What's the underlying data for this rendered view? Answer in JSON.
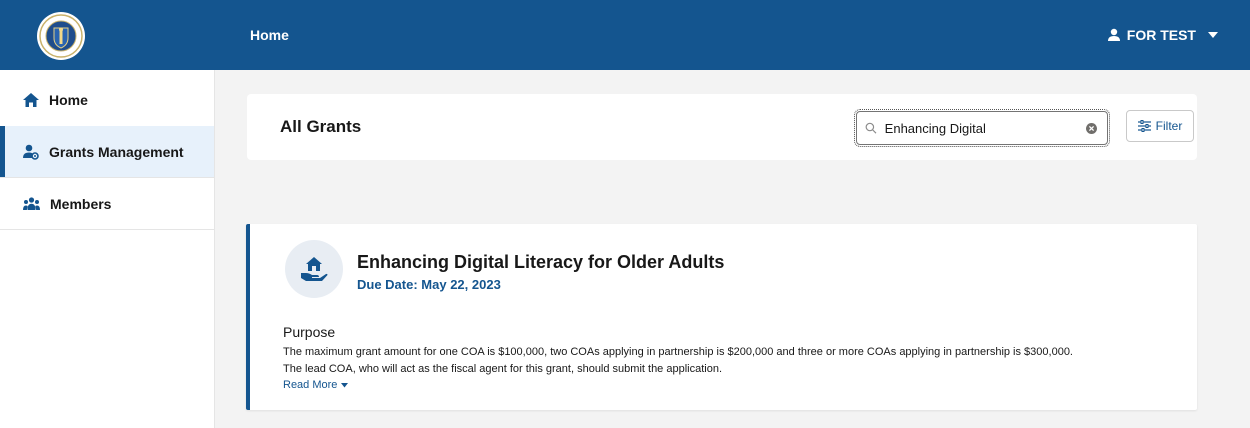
{
  "header": {
    "title": "Home",
    "user_name": "FOR TEST"
  },
  "sidebar": {
    "items": [
      {
        "label": "Home",
        "icon": "home-icon"
      },
      {
        "label": "Grants Management",
        "icon": "user-settings-icon",
        "active": true
      },
      {
        "label": "Members",
        "icon": "group-icon"
      }
    ]
  },
  "grants_header": {
    "title": "All Grants",
    "search_value": "Enhancing Digital",
    "filter_label": "Filter"
  },
  "grant": {
    "title": "Enhancing Digital Literacy for Older Adults",
    "due_date": "Due Date: May 22, 2023",
    "purpose_heading": "Purpose",
    "purpose_line1": "The maximum grant amount for one COA is $100,000, two COAs applying in partnership is $200,000 and three or more COAs applying in partnership is $300,000.",
    "purpose_line2": "The lead COA, who will act as the fiscal agent for this grant, should submit the application.",
    "read_more": "Read More"
  },
  "colors": {
    "brand": "#14558f",
    "active_nav_bg": "#e7f1fb",
    "page_bg": "#f3f3f3"
  }
}
